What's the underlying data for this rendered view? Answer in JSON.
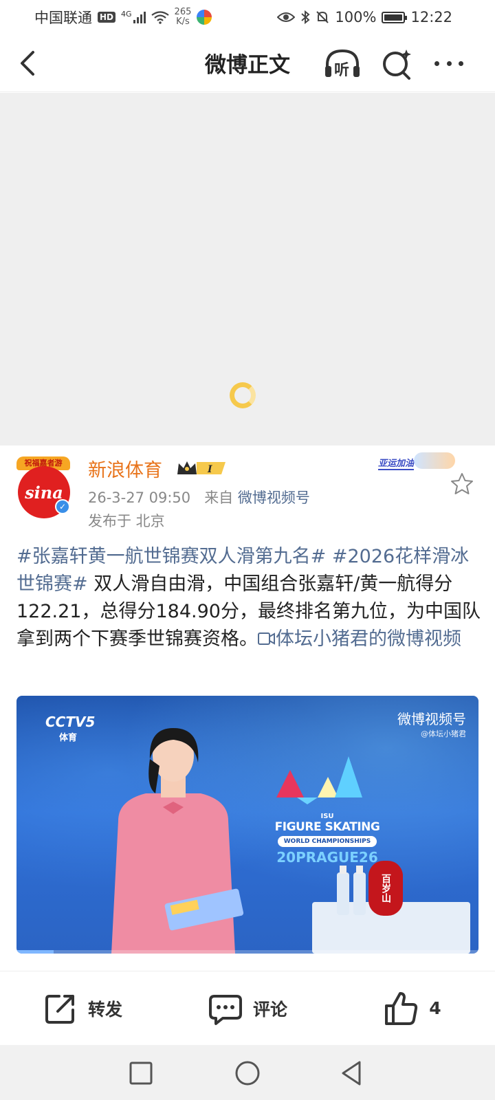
{
  "status_bar": {
    "carrier": "中国联通",
    "hd": "HD",
    "network": "4G",
    "net_speed_value": "265",
    "net_speed_unit": "K/s",
    "battery": "100%",
    "time": "12:22"
  },
  "nav": {
    "title": "微博正文",
    "listen_label": "听"
  },
  "post": {
    "avatar_tag": "祝福嘉者游",
    "avatar_logo": "sina",
    "author": "新浪体育",
    "timestamp": "26-3-27 09:50",
    "source_prefix": "来自",
    "source": "微博视频号",
    "location": "发布于 北京",
    "badge_text": "亚运加油",
    "topic1": "#张嘉轩黄一航世锦赛双人滑第九名#",
    "topic2": "#2026花样滑冰世锦赛#",
    "body": " 双人滑自由滑，中国组合张嘉轩/黄一航得分122.21，总得分184.90分，最终排名第九位，为中国队拿到两个下赛季世锦赛资格。",
    "video_link": "体坛小猪君的微博视频"
  },
  "video": {
    "channel": "CCTV5",
    "channel_sub": "体育",
    "watermark": "微博视频号",
    "watermark_user": "@体坛小猪君",
    "isu_small": "ISU",
    "isu_title": "FIGURE SKATING",
    "isu_sub": "WORLD CHAMPIONSHIPS",
    "isu_city": "20PRAGUE26",
    "sponsor": "百岁山",
    "progress": 0.08
  },
  "actions": {
    "repost_label": "转发",
    "comment_label": "评论",
    "like_count": "4"
  },
  "colors": {
    "link": "#536c91",
    "author": "#e8731a",
    "placeholder_bg": "#efefef",
    "spinner": "#f6c94c"
  }
}
